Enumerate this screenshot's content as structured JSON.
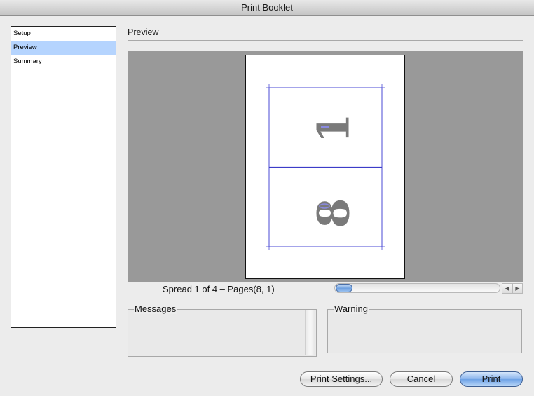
{
  "window": {
    "title": "Print Booklet"
  },
  "sidebar": {
    "items": [
      {
        "label": "Setup",
        "selected": false
      },
      {
        "label": "Preview",
        "selected": true
      },
      {
        "label": "Summary",
        "selected": false
      }
    ]
  },
  "preview": {
    "section_title": "Preview",
    "spread_label": "Spread 1 of 4 – Pages(8, 1)",
    "page_top_number": "1",
    "page_bottom_number": "8"
  },
  "messages": {
    "label": "Messages"
  },
  "warning": {
    "label": "Warning"
  },
  "buttons": {
    "print_settings": "Print Settings...",
    "cancel": "Cancel",
    "print": "Print"
  },
  "colors": {
    "selection": "#b5d4fe",
    "preview_background": "#999999",
    "guide_lines": "#4a4ad4",
    "page_numbers": "#7a7a7a"
  }
}
